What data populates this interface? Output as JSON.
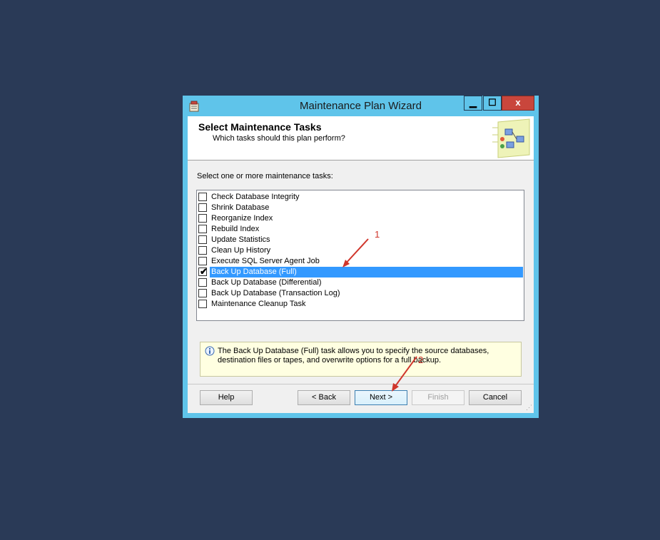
{
  "window": {
    "title": "Maintenance Plan Wizard",
    "controls": {
      "minimize": "▁",
      "maximize": "☐",
      "close": "x"
    }
  },
  "header": {
    "title": "Select Maintenance Tasks",
    "subtitle": "Which tasks should this plan perform?"
  },
  "prompt": "Select one or more maintenance tasks:",
  "tasks": [
    {
      "label": "Check Database Integrity",
      "checked": false
    },
    {
      "label": "Shrink Database",
      "checked": false
    },
    {
      "label": "Reorganize Index",
      "checked": false
    },
    {
      "label": "Rebuild Index",
      "checked": false
    },
    {
      "label": "Update Statistics",
      "checked": false
    },
    {
      "label": "Clean Up History",
      "checked": false
    },
    {
      "label": "Execute SQL Server Agent Job",
      "checked": false
    },
    {
      "label": "Back Up Database (Full)",
      "checked": true,
      "selected": true
    },
    {
      "label": "Back Up Database (Differential)",
      "checked": false
    },
    {
      "label": "Back Up Database (Transaction Log)",
      "checked": false
    },
    {
      "label": "Maintenance Cleanup Task",
      "checked": false
    }
  ],
  "description": "The Back Up Database (Full) task allows you to specify the source databases, destination files or tapes, and overwrite options for a full backup.",
  "buttons": {
    "help": "Help",
    "back": "< Back",
    "next": "Next >",
    "finish": "Finish",
    "cancel": "Cancel"
  },
  "annotations": {
    "one": "1",
    "two": "2"
  },
  "colors": {
    "background": "#2a3a57",
    "titlebar": "#5fc4ea",
    "selection": "#3399ff",
    "arrow": "#d0362c"
  },
  "icons": {
    "app": "wizard-app-icon",
    "info": "info-icon",
    "header_art": "wizard-header-graphic"
  }
}
